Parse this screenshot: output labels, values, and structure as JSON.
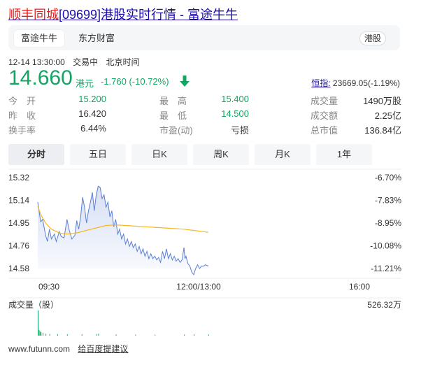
{
  "header": {
    "title_highlight": "顺丰同城",
    "title_rest": "[09699]港股实时行情 - 富途牛牛"
  },
  "source_tabs": [
    {
      "label": "富途牛牛",
      "active": true
    },
    {
      "label": "东方财富",
      "active": false
    }
  ],
  "market_badge": "港股",
  "meta": {
    "datetime": "12-14 13:30:00",
    "status": "交易中",
    "timezone": "北京时间"
  },
  "quote": {
    "price": "14.660",
    "currency": "港元",
    "change": "-1.760 (-10.72%)",
    "direction": "down",
    "index_label": "恒指:",
    "index_value": "23669.05(-1.19%)"
  },
  "stats": [
    [
      {
        "label": "今　开",
        "value": "15.200",
        "tone": "green"
      },
      {
        "label": "最　高",
        "value": "15.400",
        "tone": "green"
      },
      {
        "label": "成交量",
        "value": "1490万股",
        "tone": "dark"
      }
    ],
    [
      {
        "label": "昨　收",
        "value": "16.420",
        "tone": "dark"
      },
      {
        "label": "最　低",
        "value": "14.500",
        "tone": "green"
      },
      {
        "label": "成交额",
        "value": "2.25亿",
        "tone": "dark"
      }
    ],
    [
      {
        "label": "换手率",
        "value": "6.44%",
        "tone": "dark"
      },
      {
        "label": "市盈(动)",
        "value": "亏损",
        "tone": "dark"
      },
      {
        "label": "总市值",
        "value": "136.84亿",
        "tone": "dark"
      }
    ]
  ],
  "period_tabs": [
    {
      "label": "分时",
      "active": true
    },
    {
      "label": "五日",
      "active": false
    },
    {
      "label": "日K",
      "active": false
    },
    {
      "label": "周K",
      "active": false
    },
    {
      "label": "月K",
      "active": false
    },
    {
      "label": "1年",
      "active": false
    }
  ],
  "colors": {
    "down": "#13a562",
    "price_line": "#5a7fd6",
    "avg_line": "#f5b820",
    "volume": "#13a562"
  },
  "chart_data": {
    "type": "line",
    "y_ticks": [
      "15.32",
      "15.14",
      "14.95",
      "14.76",
      "14.58"
    ],
    "y_range": [
      14.58,
      15.32
    ],
    "pct_ticks": [
      "-6.70%",
      "-7.83%",
      "-8.95%",
      "-10.08%",
      "-11.21%"
    ],
    "x_ticks": [
      "09:30",
      "12:00/13:00",
      "16:00"
    ],
    "x_range_minutes": [
      0,
      330
    ],
    "series": [
      {
        "values": [
          [
            0,
            15.12
          ],
          [
            3,
            14.96
          ],
          [
            5,
            14.98
          ],
          [
            8,
            14.85
          ],
          [
            10,
            14.8
          ],
          [
            12,
            14.9
          ],
          [
            14,
            14.82
          ],
          [
            17,
            14.86
          ],
          [
            19,
            14.8
          ],
          [
            22,
            14.88
          ],
          [
            24,
            14.84
          ],
          [
            27,
            14.83
          ],
          [
            30,
            14.98
          ],
          [
            32,
            14.9
          ],
          [
            35,
            14.82
          ],
          [
            38,
            14.85
          ],
          [
            40,
            14.97
          ],
          [
            42,
            14.9
          ],
          [
            44,
            15.0
          ],
          [
            46,
            15.16
          ],
          [
            48,
            15.08
          ],
          [
            50,
            14.95
          ],
          [
            52,
            15.05
          ],
          [
            54,
            15.12
          ],
          [
            56,
            15.2
          ],
          [
            58,
            15.05
          ],
          [
            60,
            15.18
          ],
          [
            62,
            15.25
          ],
          [
            64,
            15.24
          ],
          [
            66,
            15.15
          ],
          [
            68,
            15.18
          ],
          [
            70,
            15.08
          ],
          [
            72,
            15.12
          ],
          [
            74,
            15.0
          ],
          [
            76,
            15.05
          ],
          [
            78,
            14.92
          ],
          [
            80,
            14.98
          ],
          [
            82,
            14.86
          ],
          [
            84,
            14.9
          ],
          [
            86,
            14.82
          ],
          [
            88,
            14.86
          ],
          [
            90,
            14.78
          ],
          [
            92,
            14.82
          ],
          [
            94,
            14.76
          ],
          [
            96,
            14.8
          ],
          [
            98,
            14.75
          ],
          [
            100,
            14.78
          ],
          [
            102,
            14.72
          ],
          [
            104,
            14.76
          ],
          [
            106,
            14.7
          ],
          [
            108,
            14.74
          ],
          [
            110,
            14.68
          ],
          [
            112,
            14.72
          ],
          [
            114,
            14.66
          ],
          [
            116,
            14.7
          ],
          [
            118,
            14.66
          ],
          [
            120,
            14.68
          ],
          [
            122,
            14.65
          ],
          [
            124,
            14.67
          ],
          [
            126,
            14.63
          ],
          [
            128,
            14.72
          ],
          [
            130,
            14.66
          ],
          [
            132,
            14.74
          ],
          [
            134,
            14.66
          ],
          [
            136,
            14.7
          ],
          [
            138,
            14.65
          ],
          [
            140,
            14.68
          ],
          [
            142,
            14.64
          ],
          [
            144,
            14.66
          ],
          [
            146,
            14.63
          ],
          [
            148,
            14.65
          ],
          [
            150,
            14.75
          ],
          [
            151,
            14.66
          ],
          [
            152,
            14.68
          ],
          [
            154,
            14.62
          ],
          [
            156,
            14.6
          ],
          [
            158,
            14.55
          ],
          [
            160,
            14.53
          ],
          [
            162,
            14.58
          ],
          [
            164,
            14.61
          ],
          [
            166,
            14.58
          ],
          [
            168,
            14.6
          ],
          [
            170,
            14.6
          ],
          [
            172,
            14.61
          ],
          [
            175,
            14.6
          ]
        ]
      },
      {
        "values": [
          [
            0,
            15.09
          ],
          [
            3,
            15.02
          ],
          [
            8,
            14.95
          ],
          [
            14,
            14.9
          ],
          [
            22,
            14.87
          ],
          [
            30,
            14.86
          ],
          [
            40,
            14.87
          ],
          [
            50,
            14.89
          ],
          [
            60,
            14.91
          ],
          [
            70,
            14.93
          ],
          [
            80,
            14.935
          ],
          [
            90,
            14.93
          ],
          [
            100,
            14.925
          ],
          [
            110,
            14.92
          ],
          [
            120,
            14.915
          ],
          [
            130,
            14.91
          ],
          [
            140,
            14.905
          ],
          [
            150,
            14.9
          ],
          [
            160,
            14.89
          ],
          [
            170,
            14.88
          ],
          [
            175,
            14.875
          ]
        ]
      }
    ],
    "volume_label": "成交量（股）",
    "volume_max_label": "526.32万",
    "volume_max": 5263200,
    "volume_bars": [
      [
        0,
        5263200
      ],
      [
        1,
        1200000
      ],
      [
        2,
        900000
      ],
      [
        3,
        700000
      ],
      [
        5,
        600000
      ],
      [
        8,
        400000
      ],
      [
        12,
        350000
      ],
      [
        20,
        300000
      ],
      [
        30,
        280000
      ],
      [
        45,
        300000
      ],
      [
        60,
        320000
      ],
      [
        62,
        400000
      ],
      [
        80,
        250000
      ],
      [
        100,
        220000
      ],
      [
        120,
        200000
      ],
      [
        150,
        220000
      ],
      [
        160,
        300000
      ],
      [
        175,
        250000
      ]
    ]
  },
  "footer": {
    "site": "www.futunn.com",
    "feedback_link": "给百度提建议"
  }
}
